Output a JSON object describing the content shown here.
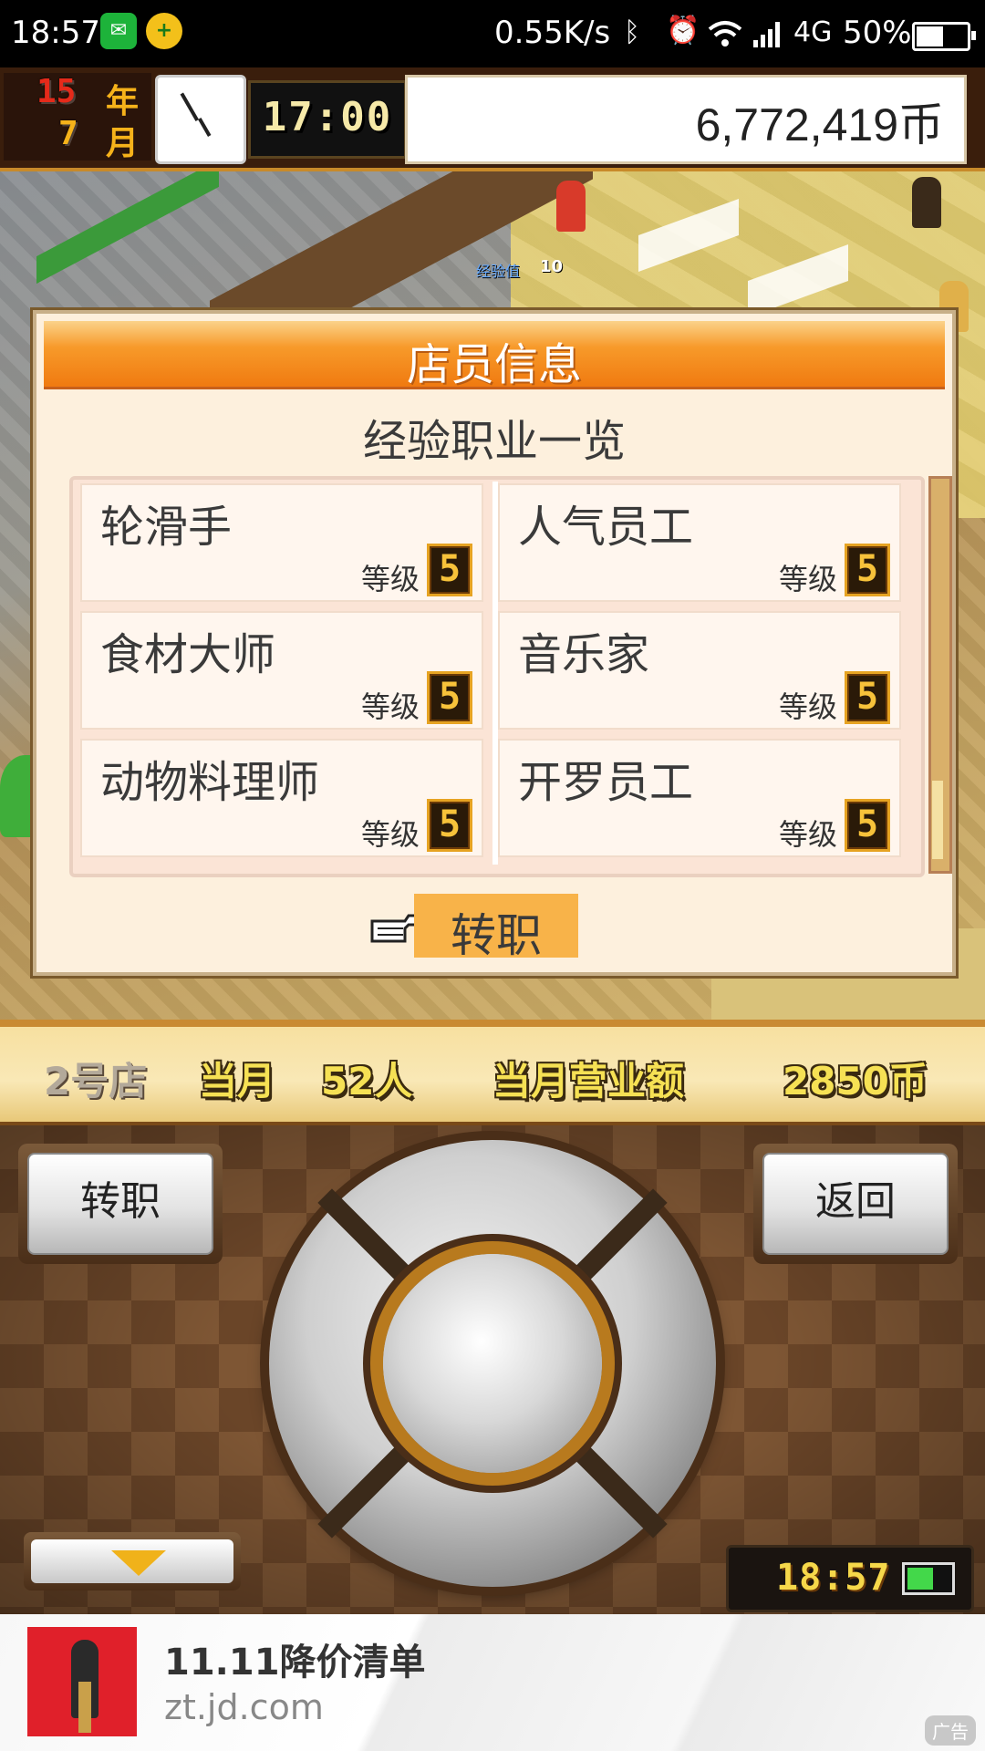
{
  "status_bar": {
    "time": "18:57",
    "network_speed": "0.55K/s",
    "signal_type": "4G",
    "battery_percent": "50%",
    "battery_level": 0.5,
    "icons": [
      "wechat-icon",
      "plus-app-icon",
      "bluetooth-icon",
      "alarm-icon",
      "wifi-icon",
      "signal-icon",
      "battery-icon"
    ]
  },
  "game_header": {
    "year_number": "15",
    "year_unit": "年",
    "month_number": "7",
    "month_unit": "月",
    "time": "17:00",
    "money": "6,772,419币"
  },
  "dialog": {
    "title": "店员信息",
    "subtitle": "经验职业一览",
    "jobs": [
      {
        "name": "轮滑手",
        "level_label": "等级",
        "level": "5"
      },
      {
        "name": "人气员工",
        "level_label": "等级",
        "level": "5"
      },
      {
        "name": "食材大师",
        "level_label": "等级",
        "level": "5"
      },
      {
        "name": "音乐家",
        "level_label": "等级",
        "level": "5"
      },
      {
        "name": "动物料理师",
        "level_label": "等级",
        "level": "5"
      },
      {
        "name": "开罗员工",
        "level_label": "等级",
        "level": "5"
      }
    ],
    "action_label": "转职"
  },
  "store_bar": {
    "store": "2号店",
    "month_label": "当月",
    "customers": "52人",
    "revenue_label": "当月营业额",
    "revenue": "2850币"
  },
  "controller": {
    "left_button": "转职",
    "right_button": "返回",
    "clock": "18:57"
  },
  "ad": {
    "title": "11.11降价清单",
    "url": "zt.jd.com",
    "tag": "广告"
  },
  "world_labels": {
    "exp_label": "经验值",
    "exp_value": "10"
  },
  "colors": {
    "header_orange": "#f07a10",
    "dialog_bg": "#fdf0dd",
    "selection": "#f8b349",
    "badge_gold": "#f7c23a"
  }
}
